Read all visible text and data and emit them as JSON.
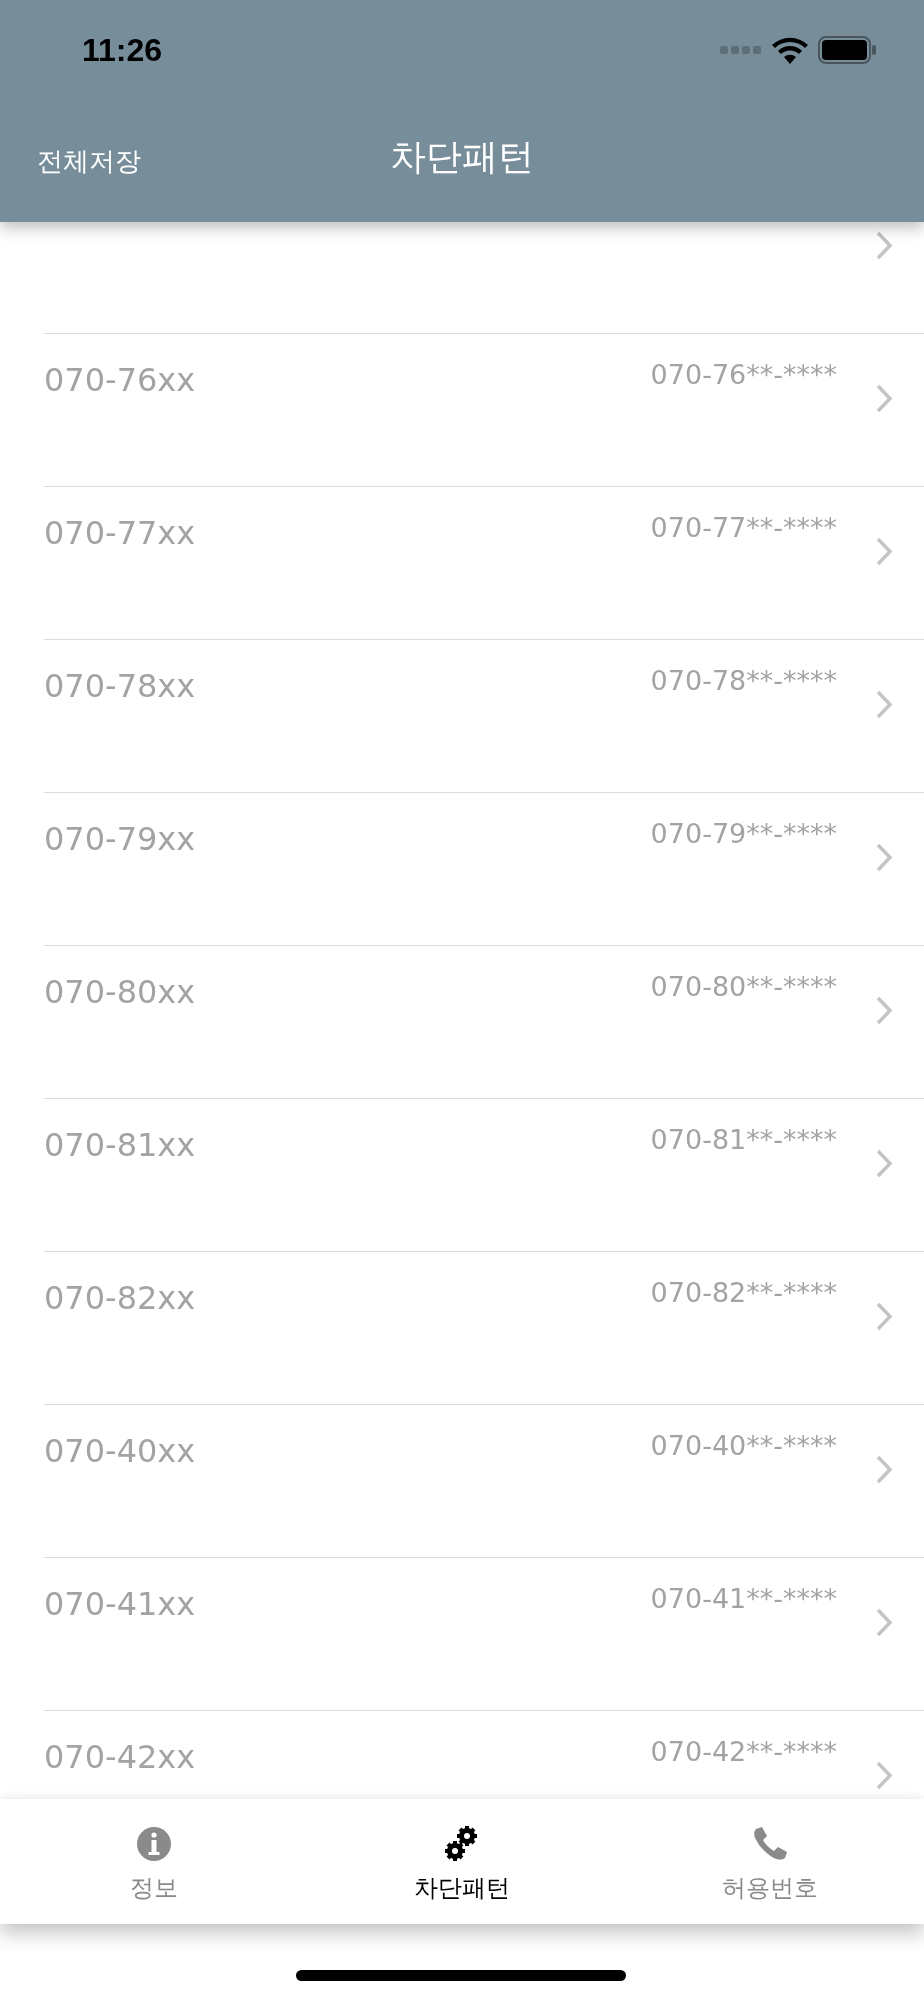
{
  "status_bar": {
    "time": "11:26"
  },
  "nav_bar": {
    "left_button": "전체저장",
    "title": "차단패턴"
  },
  "patterns": [
    {
      "label": "070-76xx",
      "value": "070-76**-****"
    },
    {
      "label": "070-77xx",
      "value": "070-77**-****"
    },
    {
      "label": "070-78xx",
      "value": "070-78**-****"
    },
    {
      "label": "070-79xx",
      "value": "070-79**-****"
    },
    {
      "label": "070-80xx",
      "value": "070-80**-****"
    },
    {
      "label": "070-81xx",
      "value": "070-81**-****"
    },
    {
      "label": "070-82xx",
      "value": "070-82**-****"
    },
    {
      "label": "070-40xx",
      "value": "070-40**-****"
    },
    {
      "label": "070-41xx",
      "value": "070-41**-****"
    },
    {
      "label": "070-42xx",
      "value": "070-42**-****"
    }
  ],
  "tabs": [
    {
      "label": "정보",
      "kind": "info",
      "selected": false
    },
    {
      "label": "차단패턴",
      "kind": "gears",
      "selected": true
    },
    {
      "label": "허용번호",
      "kind": "phone",
      "selected": false
    }
  ]
}
